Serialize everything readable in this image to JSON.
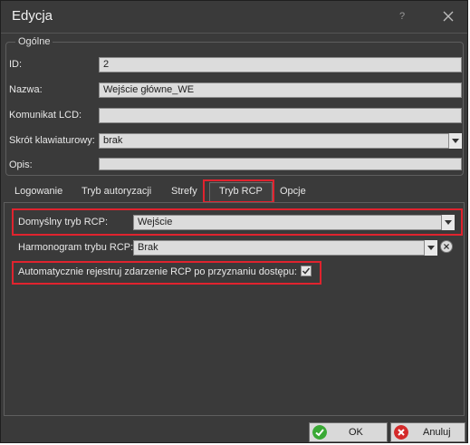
{
  "window": {
    "title": "Edycja",
    "help": "?"
  },
  "general": {
    "legend": "Ogólne",
    "id_label": "ID:",
    "id_value": "2",
    "name_label": "Nazwa:",
    "name_value": "Wejście główne_WE",
    "lcd_label": "Komunikat LCD:",
    "lcd_value": "",
    "shortcut_label": "Skrót klawiaturowy:",
    "shortcut_value": "brak",
    "desc_label": "Opis:",
    "desc_value": ""
  },
  "tabs": [
    {
      "label": "Logowanie"
    },
    {
      "label": "Tryb autoryzacji"
    },
    {
      "label": "Strefy"
    },
    {
      "label": "Tryb RCP"
    },
    {
      "label": "Opcje"
    }
  ],
  "active_tab": "Tryb RCP",
  "rcp": {
    "default_mode_label": "Domyślny tryb RCP:",
    "default_mode_value": "Wejście",
    "schedule_label": "Harmonogram trybu RCP:",
    "schedule_value": "Brak",
    "auto_register_label": "Automatycznie rejestruj zdarzenie RCP po przyznaniu dostępu:",
    "auto_register_checked": true
  },
  "buttons": {
    "ok": "OK",
    "cancel": "Anuluj"
  },
  "colors": {
    "background": "#3a3a3a",
    "highlight": "#e0232e",
    "ok_icon": "#3aa935",
    "cancel_icon": "#d42a2a"
  }
}
